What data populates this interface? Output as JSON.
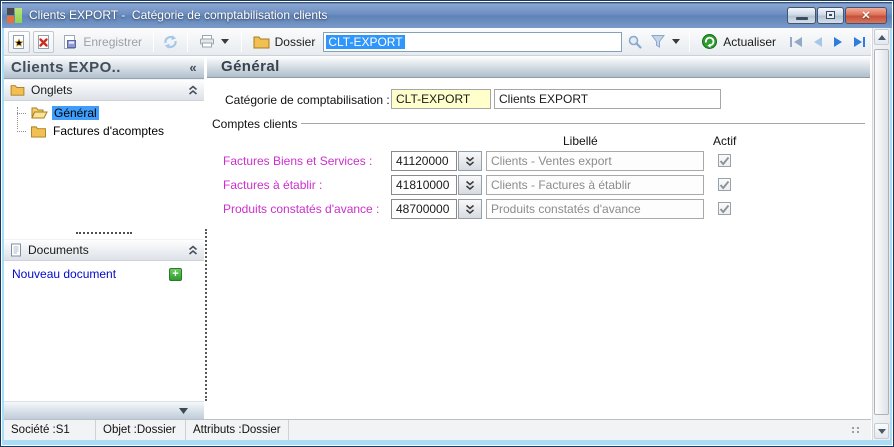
{
  "window": {
    "title": "Clients EXPORT -  Catégorie de comptabilisation clients"
  },
  "toolbar": {
    "save_label": "Enregistrer",
    "dossier_label": "Dossier",
    "search_value": "CLT-EXPORT",
    "actualiser_label": "Actualiser"
  },
  "sidebar": {
    "title": "Clients EXPO..",
    "collapse_glyph": "«",
    "onglets": {
      "label": "Onglets",
      "items": [
        {
          "label": "Général",
          "selected": true
        },
        {
          "label": "Factures d'acomptes",
          "selected": false
        }
      ]
    },
    "documents": {
      "label": "Documents",
      "new_doc_label": "Nouveau document",
      "add_glyph": "+"
    }
  },
  "main": {
    "title": "Général",
    "category_label": "Catégorie de comptabilisation :",
    "category_code": "CLT-EXPORT",
    "category_name": "Clients EXPORT",
    "group": {
      "label": "Comptes clients",
      "col_libelle": "Libellé",
      "col_actif": "Actif",
      "rows": [
        {
          "label": "Factures Biens et Services :",
          "account": "41120000",
          "libelle": "Clients - Ventes export",
          "actif": true
        },
        {
          "label": "Factures à établir :",
          "account": "41810000",
          "libelle": "Clients - Factures à établir",
          "actif": true
        },
        {
          "label": "Produits constatés d'avance :",
          "account": "48700000",
          "libelle": "Produits constatés d'avance",
          "actif": true
        }
      ]
    }
  },
  "statusbar": {
    "societe": "Société :S1",
    "objet": "Objet :Dossier",
    "attributs": "Attributs :Dossier"
  },
  "colors": {
    "titlebar_blue": "#6d8fc2",
    "selection_blue": "#2f96fb",
    "tree_selection_blue": "#3f9efc",
    "magenta_label": "#cc2fcc",
    "field_yellow": "#ffffcc",
    "link_blue": "#0009cf",
    "frame_light_blue": "#a9dcf6"
  }
}
